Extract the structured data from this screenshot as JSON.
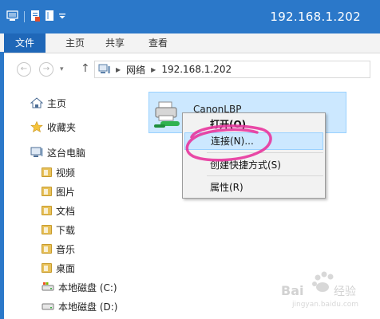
{
  "window": {
    "title": "192.168.1.202",
    "accent_color": "#2b78c9"
  },
  "quick_access": {
    "icons": [
      "computer-icon",
      "properties-icon",
      "new-folder-icon",
      "customize-dropdown-icon"
    ]
  },
  "ribbon": {
    "tabs": [
      {
        "label": "文件"
      },
      {
        "label": "主页"
      },
      {
        "label": "共享"
      },
      {
        "label": "查看"
      }
    ]
  },
  "address_bar": {
    "segments": [
      "网络",
      "192.168.1.202"
    ]
  },
  "sidebar": {
    "items": [
      {
        "label": "主页",
        "icon": "home-icon"
      },
      {
        "label": "收藏夹",
        "icon": "star-icon"
      },
      {
        "label": "这台电脑",
        "icon": "computer-icon"
      },
      {
        "label": "视频",
        "icon": "video-folder-icon"
      },
      {
        "label": "图片",
        "icon": "pictures-folder-icon"
      },
      {
        "label": "文档",
        "icon": "documents-folder-icon"
      },
      {
        "label": "下载",
        "icon": "downloads-folder-icon"
      },
      {
        "label": "音乐",
        "icon": "music-folder-icon"
      },
      {
        "label": "桌面",
        "icon": "desktop-folder-icon"
      },
      {
        "label": "本地磁盘 (C:)",
        "icon": "drive-c-icon"
      },
      {
        "label": "本地磁盘 (D:)",
        "icon": "drive-d-icon"
      }
    ]
  },
  "content": {
    "items": [
      {
        "name": "CanonLBP",
        "icon": "printer-icon"
      }
    ]
  },
  "context_menu": {
    "items": [
      {
        "label": "打开(O)"
      },
      {
        "label": "连接(N)..."
      },
      {
        "label": "创建快捷方式(S)"
      },
      {
        "label": "属性(R)"
      }
    ],
    "highlight_color": "#e8359d"
  },
  "watermark": {
    "text": "Baidu 经验"
  }
}
